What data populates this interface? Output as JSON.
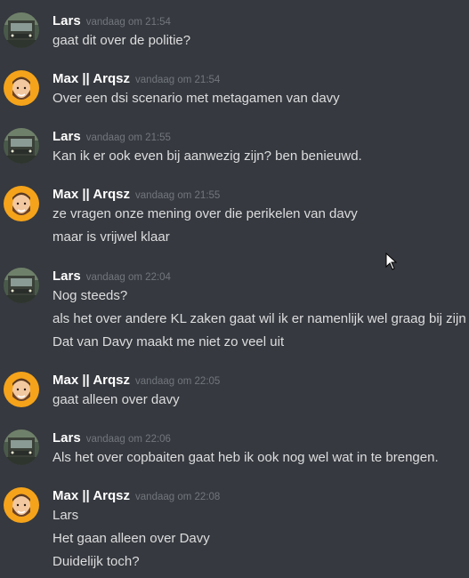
{
  "users": {
    "lars": {
      "name": "Lars"
    },
    "max": {
      "name": "Max || Arqsz"
    }
  },
  "colors": {
    "background": "#36393f",
    "username": "#ffffff",
    "message_text": "#dcddde",
    "timestamp": "#72767d",
    "max_avatar_bg": "#f5a31a"
  },
  "messages": [
    {
      "author": "Lars",
      "avatar": "truck-avatar",
      "timestamp": "vandaag om 21:54",
      "lines": [
        "gaat dit over de politie?"
      ]
    },
    {
      "author": "Max || Arqsz",
      "avatar": "bearded-man-avatar",
      "timestamp": "vandaag om 21:54",
      "lines": [
        "Over een dsi scenario met metagamen van davy"
      ]
    },
    {
      "author": "Lars",
      "avatar": "truck-avatar",
      "timestamp": "vandaag om 21:55",
      "lines": [
        "Kan ik er ook even bij aanwezig zijn? ben benieuwd."
      ]
    },
    {
      "author": "Max || Arqsz",
      "avatar": "bearded-man-avatar",
      "timestamp": "vandaag om 21:55",
      "lines": [
        "ze vragen onze mening over die perikelen van davy",
        "maar is vrijwel klaar"
      ]
    },
    {
      "author": "Lars",
      "avatar": "truck-avatar",
      "timestamp": "vandaag om 22:04",
      "lines": [
        "Nog steeds?",
        "als het over andere KL zaken gaat wil ik er namenlijk wel graag bij zijn",
        "Dat van Davy maakt me niet zo veel uit"
      ]
    },
    {
      "author": "Max || Arqsz",
      "avatar": "bearded-man-avatar",
      "timestamp": "vandaag om 22:05",
      "lines": [
        "gaat alleen over davy"
      ]
    },
    {
      "author": "Lars",
      "avatar": "truck-avatar",
      "timestamp": "vandaag om 22:06",
      "lines": [
        "Als het over copbaiten gaat heb ik ook nog wel wat in te brengen."
      ]
    },
    {
      "author": "Max || Arqsz",
      "avatar": "bearded-man-avatar",
      "timestamp": "vandaag om 22:08",
      "lines": [
        "Lars",
        "Het gaan alleen over Davy",
        "Duidelijk toch?"
      ]
    }
  ]
}
